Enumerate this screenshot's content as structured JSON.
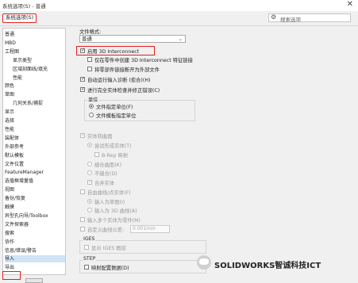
{
  "window": {
    "title": "系统选项(S) - 普通",
    "close_glyph": "✕"
  },
  "tabs": {
    "active": "系统选项(S)"
  },
  "search": {
    "placeholder": "搜索选项"
  },
  "tree": [
    {
      "label": "普通",
      "level": 0
    },
    {
      "label": "MBD",
      "level": 0
    },
    {
      "label": "工程图",
      "level": 0
    },
    {
      "label": "显示类型",
      "level": 1
    },
    {
      "label": "区域剖面线/填充",
      "level": 1
    },
    {
      "label": "性能",
      "level": 1
    },
    {
      "label": "颜色",
      "level": 0
    },
    {
      "label": "草图",
      "level": 0
    },
    {
      "label": "几何关系/捕捉",
      "level": 1
    },
    {
      "label": "显示",
      "level": 0
    },
    {
      "label": "选择",
      "level": 0
    },
    {
      "label": "性能",
      "level": 0
    },
    {
      "label": "装配体",
      "level": 0
    },
    {
      "label": "外部参考",
      "level": 0
    },
    {
      "label": "默认模板",
      "level": 0
    },
    {
      "label": "文件位置",
      "level": 0
    },
    {
      "label": "FeatureManager",
      "level": 0
    },
    {
      "label": "选值框增量值",
      "level": 0
    },
    {
      "label": "视图",
      "level": 0
    },
    {
      "label": "备份/恢复",
      "level": 0
    },
    {
      "label": "触摸",
      "level": 0
    },
    {
      "label": "异型孔向导/Toolbox",
      "level": 0
    },
    {
      "label": "文件探索器",
      "level": 0
    },
    {
      "label": "搜索",
      "level": 0
    },
    {
      "label": "协作",
      "level": 0
    },
    {
      "label": "信息/错误/警告",
      "level": 0
    },
    {
      "label": "导入",
      "level": 0,
      "selected": true
    },
    {
      "label": "导出",
      "level": 0
    }
  ],
  "panel": {
    "file_format_label": "文件格式:",
    "file_format_value": "普通",
    "dropdown_arrow": "⌄",
    "enable_3di": "启用 3D Interconnect",
    "only_create_in_part": "仅在零件中创建 3D Interconnect 特征链接",
    "break_link_external": "将零部件链接断开为外部文件",
    "auto_run_import_diag": "自动运行输入诊断 (愈合)(H)",
    "run_full_check": "进行完全实体检查并修正错误(C)",
    "unit_group": "单位",
    "unit_file_specified": "文件指定单位(F)",
    "unit_template_specified": "文件模板指定单位",
    "solids_surfaces": "实体和曲面",
    "try_form_solid": "尝试形成实体(T)",
    "brep_mapping": "B-Rep 映射",
    "knit_surfaces": "缝合曲面(K)",
    "no_knit": "不缝合(D)",
    "merge_entities": "合并实体",
    "free_curves": "自由曲线/点实体(F)",
    "import_as_sketch": "输入为草图(I)",
    "import_as_3d_curve": "输入为 3D 曲线(A)",
    "import_multiple_bodies": "输入多个实体为零件(M)",
    "custom_tolerance": "自定义曲线公差:",
    "tolerance_value": "0.001mm",
    "iges_group": "IGES",
    "show_iges_levels": "显示 IGES 图层",
    "step_group": "STEP",
    "map_config_data": "映射配置数据(D)"
  },
  "watermark": {
    "text": "SOLIDWORKS智诚科技ICT"
  },
  "colors": {
    "highlight_red": "#e02020",
    "selection_blue": "#cfe3f7"
  }
}
